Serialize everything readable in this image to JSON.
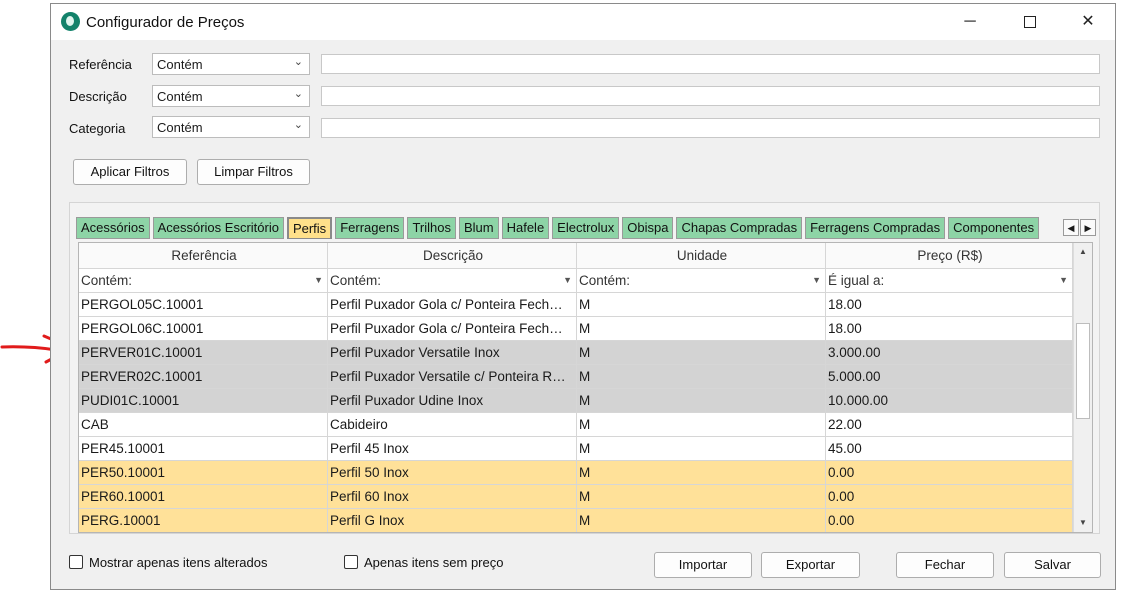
{
  "window": {
    "title": "Configurador de Preços",
    "minimize": "─",
    "close": "✕"
  },
  "filters": [
    {
      "label": "Referência",
      "operator": "Contém",
      "value": ""
    },
    {
      "label": "Descrição",
      "operator": "Contém",
      "value": ""
    },
    {
      "label": "Categoria",
      "operator": "Contém",
      "value": ""
    }
  ],
  "buttons": {
    "apply": "Aplicar Filtros",
    "clear": "Limpar Filtros",
    "import": "Importar",
    "export": "Exportar",
    "close": "Fechar",
    "save": "Salvar"
  },
  "tabs": [
    "Acessórios",
    "Acessórios Escritório",
    "Perfis",
    "Ferragens",
    "Trilhos",
    "Blum",
    "Hafele",
    "Electrolux",
    "Obispa",
    "Chapas Compradas",
    "Ferragens Compradas",
    "Componentes"
  ],
  "active_tab": "Perfis",
  "grid": {
    "columns": [
      "Referência",
      "Descrição",
      "Unidade",
      "Preço (R$)"
    ],
    "filter_row": [
      "Contém:",
      "Contém:",
      "Contém:",
      "É igual a:"
    ],
    "rows": [
      {
        "ref": "PERGOL05C.10001",
        "desc": "Perfil Puxador Gola c/ Ponteira Fech…",
        "unit": "M",
        "price": "18.00",
        "highlight": "none"
      },
      {
        "ref": "PERGOL06C.10001",
        "desc": "Perfil Puxador Gola c/ Ponteira Fech…",
        "unit": "M",
        "price": "18.00",
        "highlight": "none"
      },
      {
        "ref": "PERVER01C.10001",
        "desc": "Perfil Puxador Versatile Inox",
        "unit": "M",
        "price": "3.000.00",
        "highlight": "gray"
      },
      {
        "ref": "PERVER02C.10001",
        "desc": "Perfil Puxador Versatile c/ Ponteira R…",
        "unit": "M",
        "price": "5.000.00",
        "highlight": "gray"
      },
      {
        "ref": "PUDI01C.10001",
        "desc": "Perfil Puxador Udine Inox",
        "unit": "M",
        "price": "10.000.00",
        "highlight": "gray"
      },
      {
        "ref": "CAB",
        "desc": "Cabideiro",
        "unit": "M",
        "price": "22.00",
        "highlight": "none"
      },
      {
        "ref": "PER45.10001",
        "desc": "Perfil 45 Inox",
        "unit": "M",
        "price": "45.00",
        "highlight": "none"
      },
      {
        "ref": "PER50.10001",
        "desc": "Perfil 50 Inox",
        "unit": "M",
        "price": "0.00",
        "highlight": "yellow"
      },
      {
        "ref": "PER60.10001",
        "desc": "Perfil 60 Inox",
        "unit": "M",
        "price": "0.00",
        "highlight": "yellow"
      },
      {
        "ref": "PERG.10001",
        "desc": "Perfil G Inox",
        "unit": "M",
        "price": "0.00",
        "highlight": "yellow"
      }
    ]
  },
  "checkboxes": [
    {
      "label": "Mostrar apenas itens alterados",
      "checked": false
    },
    {
      "label": "Apenas itens sem preço",
      "checked": false
    }
  ],
  "colors": {
    "tab": "#8dd4a6",
    "tab_active": "#ffe08a",
    "row_gray": "#d3d3d3",
    "row_yellow": "#ffe199",
    "annotation_arrow": "#e11b1b"
  },
  "icons": {
    "dropdown": "chevron-down-icon",
    "filter": "funnel-icon",
    "scroll_up": "▲",
    "scroll_down": "▼",
    "tab_left": "◀",
    "tab_right": "▶",
    "funnel": "▼",
    "chevron": "⌄"
  }
}
